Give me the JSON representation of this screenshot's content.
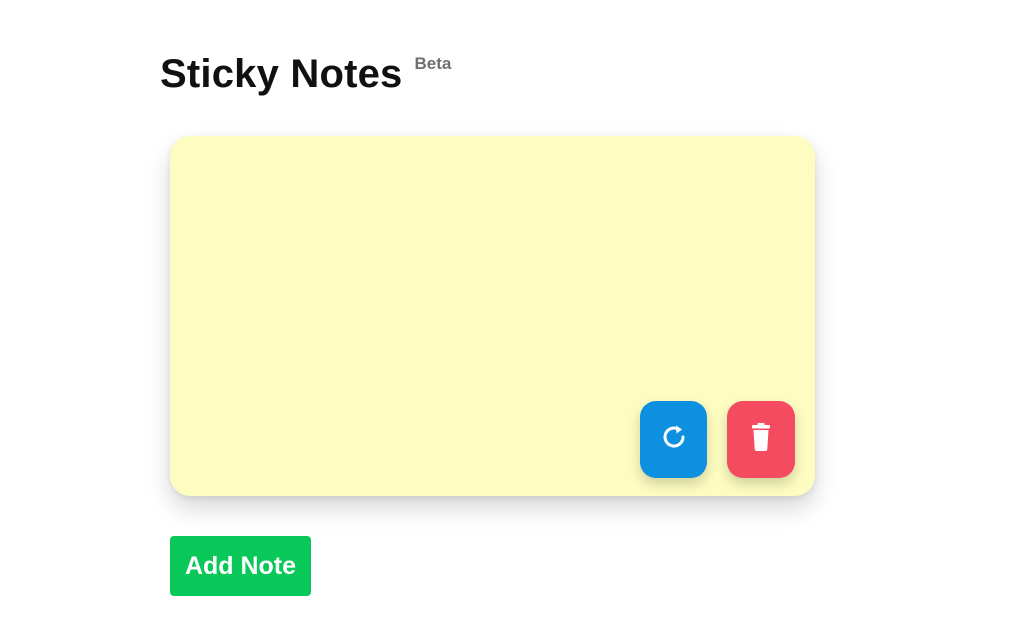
{
  "header": {
    "title": "Sticky Notes",
    "badge": "Beta"
  },
  "note": {
    "content": "",
    "background_color": "#fdfdc1",
    "refresh_icon": "refresh-icon",
    "refresh_color": "#0d90e0",
    "delete_icon": "trash-icon",
    "delete_color": "#f54b60"
  },
  "actions": {
    "add_note_label": "Add Note",
    "add_note_color": "#08c85a"
  }
}
